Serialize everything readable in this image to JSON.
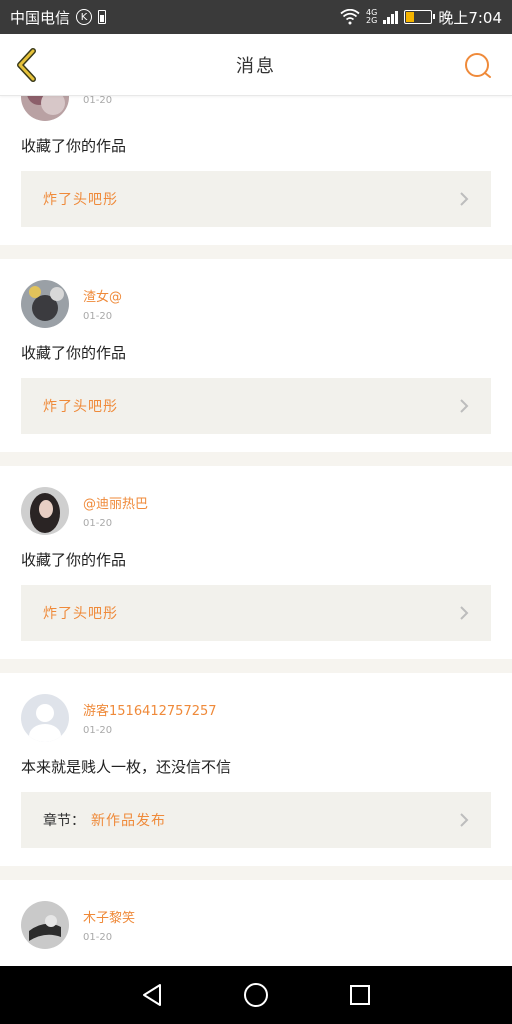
{
  "status_bar": {
    "carrier": "中国电信",
    "carrier_badge": "K",
    "network_top": "4G",
    "network_bottom": "2G",
    "battery_level": 0.3,
    "time": "晚上7:04"
  },
  "header": {
    "title": "消息",
    "back_icon": "chevron-left-icon",
    "search_icon": "search-icon",
    "accent_color": "#ef8a3a"
  },
  "feed": {
    "items": [
      {
        "username": "",
        "date": "01-20",
        "message": "收藏了你的作品",
        "link_prefix": "",
        "link_text": "炸了头吧彤"
      },
      {
        "username": "渣女@",
        "date": "01-20",
        "message": "收藏了你的作品",
        "link_prefix": "",
        "link_text": "炸了头吧彤"
      },
      {
        "username": "@迪丽热巴",
        "date": "01-20",
        "message": "收藏了你的作品",
        "link_prefix": "",
        "link_text": "炸了头吧彤"
      },
      {
        "username": "游客1516412757257",
        "date": "01-20",
        "message": "本来就是贱人一枚，还没信不信",
        "link_prefix": "章节：",
        "link_text": "新作品发布"
      },
      {
        "username": "木子黎笑",
        "date": "01-20",
        "message": "",
        "link_prefix": "",
        "link_text": ""
      }
    ]
  },
  "nav_bar": {
    "back_icon": "triangle-back-icon",
    "home_icon": "circle-home-icon",
    "recents_icon": "square-recents-icon"
  }
}
